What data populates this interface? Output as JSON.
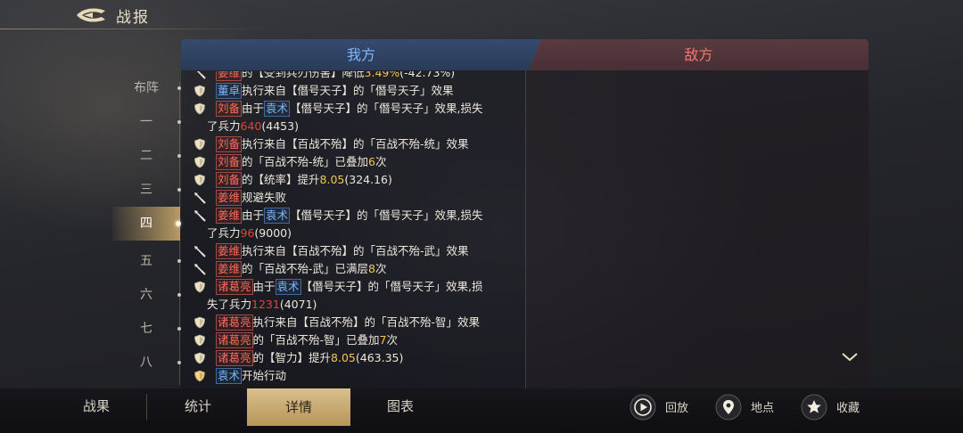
{
  "header": {
    "title": "战报",
    "back_icon": "back-arrow-icon"
  },
  "rounds": [
    "布阵",
    "一",
    "二",
    "三",
    "四",
    "五",
    "六",
    "七",
    "八"
  ],
  "active_round_index": 4,
  "tabs": {
    "ours": "我方",
    "enemy": "敌方"
  },
  "log": [
    {
      "icon": "spear",
      "parts": [
        [
          "r",
          "姜维"
        ],
        [
          "t",
          "的【受到兵刃伤害】降低"
        ],
        [
          "y",
          "3.49%"
        ],
        [
          "t",
          "(-42.73%)"
        ]
      ]
    },
    {
      "icon": "shield",
      "parts": [
        [
          "b",
          "董卓"
        ],
        [
          "t",
          "执行来自【僭号天子】的「僭号天子」效果"
        ]
      ]
    },
    {
      "icon": "shield",
      "parts": [
        [
          "r",
          "刘备"
        ],
        [
          "t",
          "由于"
        ],
        [
          "b",
          "袁术"
        ],
        [
          "t",
          "【僭号天子】的「僭号天子」效果,损失"
        ]
      ],
      "cont": [
        [
          "t",
          "了兵力"
        ],
        [
          "rn",
          "640"
        ],
        [
          "t",
          "(4453)"
        ]
      ]
    },
    {
      "icon": "shield",
      "parts": [
        [
          "r",
          "刘备"
        ],
        [
          "t",
          "执行来自【百战不殆】的「百战不殆-统」效果"
        ]
      ]
    },
    {
      "icon": "shield",
      "parts": [
        [
          "r",
          "刘备"
        ],
        [
          "t",
          "的「百战不殆-统」已叠加"
        ],
        [
          "y",
          "6"
        ],
        [
          "t",
          "次"
        ]
      ]
    },
    {
      "icon": "shield",
      "parts": [
        [
          "r",
          "刘备"
        ],
        [
          "t",
          "的【统率】提升"
        ],
        [
          "y",
          "8.05"
        ],
        [
          "t",
          "(324.16)"
        ]
      ]
    },
    {
      "icon": "spear",
      "parts": [
        [
          "r",
          "姜维"
        ],
        [
          "t",
          "规避失败"
        ]
      ]
    },
    {
      "icon": "spear",
      "parts": [
        [
          "r",
          "姜维"
        ],
        [
          "t",
          "由于"
        ],
        [
          "b",
          "袁术"
        ],
        [
          "t",
          "【僭号天子】的「僭号天子」效果,损失"
        ]
      ],
      "cont": [
        [
          "t",
          "了兵力"
        ],
        [
          "rn",
          "96"
        ],
        [
          "t",
          "(9000)"
        ]
      ]
    },
    {
      "icon": "spear",
      "parts": [
        [
          "r",
          "姜维"
        ],
        [
          "t",
          "执行来自【百战不殆】的「百战不殆-武」效果"
        ]
      ]
    },
    {
      "icon": "spear",
      "parts": [
        [
          "r",
          "姜维"
        ],
        [
          "t",
          "的「百战不殆-武」已满层"
        ],
        [
          "y",
          "8"
        ],
        [
          "t",
          "次"
        ]
      ]
    },
    {
      "icon": "shield",
      "parts": [
        [
          "r",
          "诸葛亮"
        ],
        [
          "t",
          "由于"
        ],
        [
          "b",
          "袁术"
        ],
        [
          "t",
          "【僭号天子】的「僭号天子」效果,损"
        ]
      ],
      "cont": [
        [
          "t",
          "失了兵力"
        ],
        [
          "rn",
          "1231"
        ],
        [
          "t",
          "(4071)"
        ]
      ]
    },
    {
      "icon": "shield",
      "parts": [
        [
          "r",
          "诸葛亮"
        ],
        [
          "t",
          "执行来自【百战不殆】的「百战不殆-智」效果"
        ]
      ]
    },
    {
      "icon": "shield",
      "parts": [
        [
          "r",
          "诸葛亮"
        ],
        [
          "t",
          "的「百战不殆-智」已叠加"
        ],
        [
          "y",
          "7"
        ],
        [
          "t",
          "次"
        ]
      ]
    },
    {
      "icon": "shield",
      "parts": [
        [
          "r",
          "诸葛亮"
        ],
        [
          "t",
          "的【智力】提升"
        ],
        [
          "y",
          "8.05"
        ],
        [
          "t",
          "(463.35)"
        ]
      ]
    },
    {
      "icon": "shield-gold",
      "parts": [
        [
          "b",
          "袁术"
        ],
        [
          "t",
          "开始行动"
        ]
      ]
    }
  ],
  "bottom_tabs": [
    "战果",
    "统计",
    "详情",
    "图表"
  ],
  "active_bottom_tab": 2,
  "actions": [
    {
      "label": "回放",
      "icon": "play-icon"
    },
    {
      "label": "地点",
      "icon": "location-pin-icon"
    },
    {
      "label": "收藏",
      "icon": "star-icon"
    }
  ],
  "colors": {
    "ally_tab": "#7fb6ff",
    "enemy_tab": "#ee7a6c",
    "highlight": "#f2c84b",
    "loss": "#e0453b",
    "active_gold": "#d9c08c"
  }
}
